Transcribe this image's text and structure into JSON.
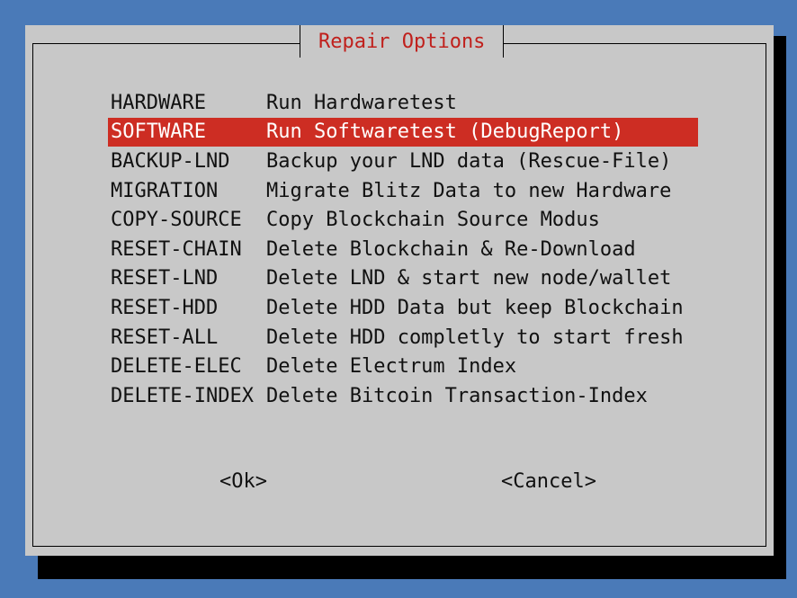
{
  "dialog": {
    "title": "Repair Options"
  },
  "menu": {
    "items": [
      {
        "tag": "HARDWARE",
        "desc": "Run Hardwaretest"
      },
      {
        "tag": "SOFTWARE",
        "desc": "Run Softwaretest (DebugReport)"
      },
      {
        "tag": "BACKUP-LND",
        "desc": "Backup your LND data (Rescue-File)"
      },
      {
        "tag": "MIGRATION",
        "desc": "Migrate Blitz Data to new Hardware"
      },
      {
        "tag": "COPY-SOURCE",
        "desc": "Copy Blockchain Source Modus"
      },
      {
        "tag": "RESET-CHAIN",
        "desc": "Delete Blockchain & Re-Download"
      },
      {
        "tag": "RESET-LND",
        "desc": "Delete LND & start new node/wallet"
      },
      {
        "tag": "RESET-HDD",
        "desc": "Delete HDD Data but keep Blockchain"
      },
      {
        "tag": "RESET-ALL",
        "desc": "Delete HDD completly to start fresh"
      },
      {
        "tag": "DELETE-ELEC",
        "desc": "Delete Electrum Index"
      },
      {
        "tag": "DELETE-INDEX",
        "desc": "Delete Bitcoin Transaction-Index"
      }
    ],
    "selected_index": 1
  },
  "buttons": {
    "ok_label": "<Ok>",
    "cancel_label": "<Cancel>"
  },
  "colors": {
    "background": "#4a7ab8",
    "dialog": "#c8c8c8",
    "title_text": "#c0201c",
    "selection": "#cd2d23"
  }
}
